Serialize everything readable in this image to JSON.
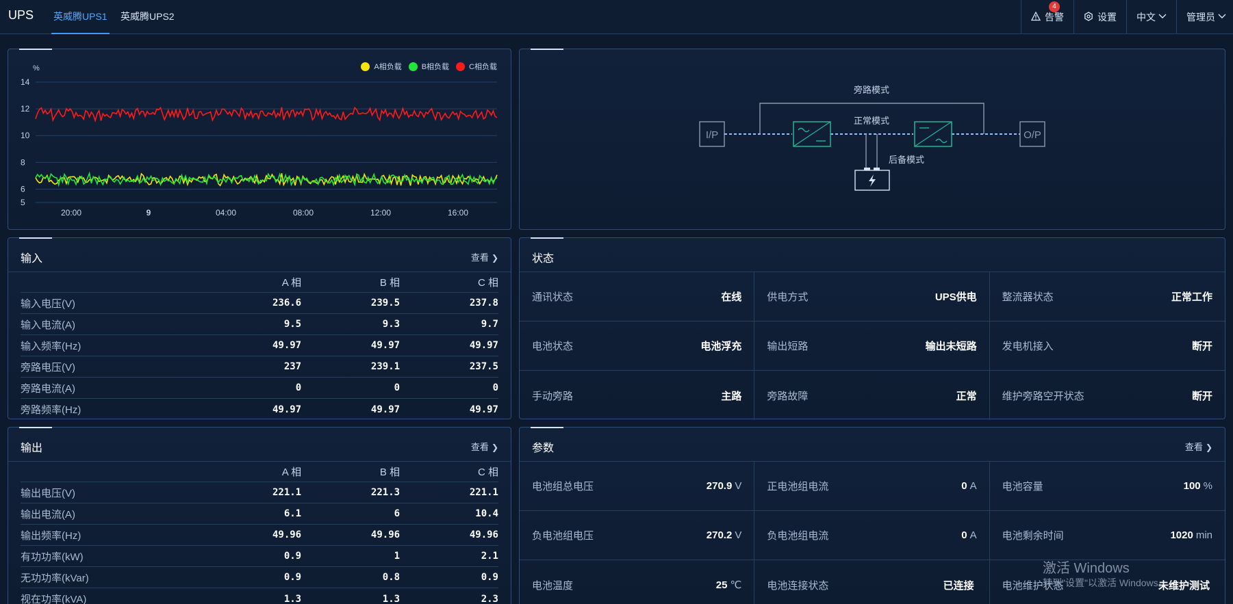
{
  "topbar": {
    "brand": "UPS",
    "tabs": [
      "英威腾UPS1",
      "英威腾UPS2"
    ],
    "alarm_label": "告警",
    "alarm_count": "4",
    "settings_label": "设置",
    "language_label": "中文",
    "user_label": "管理员"
  },
  "chart_panel": {
    "y_unit": "%",
    "legend": [
      "A相负载",
      "B相负载",
      "C相负载"
    ],
    "chart_data": {
      "type": "line",
      "x_ticks": [
        "20:00",
        "9",
        "04:00",
        "08:00",
        "12:00",
        "16:00"
      ],
      "y_ticks": [
        14,
        12,
        10,
        8,
        6,
        5
      ],
      "ylim": [
        5,
        14
      ],
      "series": [
        {
          "name": "A相负载",
          "color": "#f5e60a",
          "approx_level": 6.7,
          "jitter": 0.5
        },
        {
          "name": "B相负载",
          "color": "#22e53a",
          "approx_level": 6.7,
          "jitter": 0.5
        },
        {
          "name": "C相负载",
          "color": "#ff1a1a",
          "approx_level": 11.6,
          "jitter": 0.55
        }
      ]
    }
  },
  "diagram": {
    "bypass_mode": "旁路模式",
    "normal_mode": "正常模式",
    "backup_mode": "后备模式",
    "ip_label": "I/P",
    "op_label": "O/P"
  },
  "input_panel": {
    "title": "输入",
    "more": "查看",
    "phases": [
      "A 相",
      "B 相",
      "C 相"
    ],
    "rows": [
      {
        "label": "输入电压(V)",
        "values": [
          "236.6",
          "239.5",
          "237.8"
        ]
      },
      {
        "label": "输入电流(A)",
        "values": [
          "9.5",
          "9.3",
          "9.7"
        ]
      },
      {
        "label": "输入频率(Hz)",
        "values": [
          "49.97",
          "49.97",
          "49.97"
        ]
      },
      {
        "label": "旁路电压(V)",
        "values": [
          "237",
          "239.1",
          "237.5"
        ]
      },
      {
        "label": "旁路电流(A)",
        "values": [
          "0",
          "0",
          "0"
        ]
      },
      {
        "label": "旁路频率(Hz)",
        "values": [
          "49.97",
          "49.97",
          "49.97"
        ]
      }
    ]
  },
  "output_panel": {
    "title": "输出",
    "more": "查看",
    "phases": [
      "A 相",
      "B 相",
      "C 相"
    ],
    "rows": [
      {
        "label": "输出电压(V)",
        "values": [
          "221.1",
          "221.3",
          "221.1"
        ]
      },
      {
        "label": "输出电流(A)",
        "values": [
          "6.1",
          "6",
          "10.4"
        ]
      },
      {
        "label": "输出频率(Hz)",
        "values": [
          "49.96",
          "49.96",
          "49.96"
        ]
      },
      {
        "label": "有功功率(kW)",
        "values": [
          "0.9",
          "1",
          "2.1"
        ]
      },
      {
        "label": "无功功率(kVar)",
        "values": [
          "0.9",
          "0.8",
          "0.9"
        ]
      },
      {
        "label": "视在功率(kVA)",
        "values": [
          "1.3",
          "1.3",
          "2.3"
        ]
      }
    ]
  },
  "status_panel": {
    "title": "状态",
    "items": [
      {
        "k": "通讯状态",
        "v": "在线"
      },
      {
        "k": "供电方式",
        "v": "UPS供电"
      },
      {
        "k": "整流器状态",
        "v": "正常工作"
      },
      {
        "k": "电池状态",
        "v": "电池浮充"
      },
      {
        "k": "输出短路",
        "v": "输出未短路"
      },
      {
        "k": "发电机接入",
        "v": "断开"
      },
      {
        "k": "手动旁路",
        "v": "主路"
      },
      {
        "k": "旁路故障",
        "v": "正常"
      },
      {
        "k": "维护旁路空开状态",
        "v": "断开"
      }
    ]
  },
  "param_panel": {
    "title": "参数",
    "more": "查看",
    "items": [
      {
        "k": "电池组总电压",
        "v": "270.9",
        "u": "V"
      },
      {
        "k": "正电池组电流",
        "v": "0",
        "u": "A"
      },
      {
        "k": "电池容量",
        "v": "100",
        "u": "%"
      },
      {
        "k": "负电池组电压",
        "v": "270.2",
        "u": "V"
      },
      {
        "k": "负电池组电流",
        "v": "0",
        "u": "A"
      },
      {
        "k": "电池剩余时间",
        "v": "1020",
        "u": "min"
      },
      {
        "k": "电池温度",
        "v": "25",
        "u": "℃"
      },
      {
        "k": "电池连接状态",
        "v": "已连接",
        "u": ""
      },
      {
        "k": "电池维护状态",
        "v": "未维护测试",
        "u": ""
      }
    ]
  },
  "watermark": {
    "line1": "激活 Windows",
    "line2": "转到\"设置\"以激活 Windows。"
  }
}
